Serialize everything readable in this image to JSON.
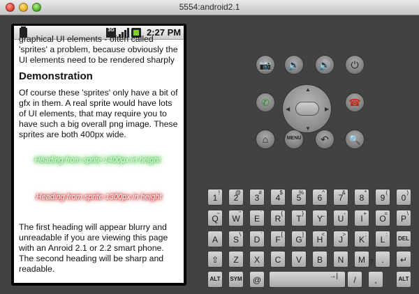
{
  "window": {
    "title": "5554:android2.1"
  },
  "statusbar": {
    "net": "3G",
    "time": "2:27 PM"
  },
  "page": {
    "intro": "graphical UI elements - often called 'sprites' a problem, because obviously the UI elements need to be rendered sharply",
    "heading": "Demonstration",
    "para1": "Of course these 'sprites' only have a bit of gfx in them. A real sprite would have lots of UI elements, that may require you to have such a big overall png image. These sprites are both 400px wide.",
    "sprite1": "Heading from sprite 1400px in height",
    "sprite2": "Heading from sprite 1300px in height",
    "para2": "The first heading will appear blurry and unreadable if you are viewing this page with an Anroid 2.1 or 2.2 smart phone. The second heading will be sharp and readable."
  },
  "controls": {
    "camera": "camera-icon",
    "vol_down": "volume-down-icon",
    "vol_up": "volume-up-icon",
    "power": "power-icon",
    "call": "call-icon",
    "end_call": "end-call-icon",
    "home": "home-icon",
    "menu_label": "MENU",
    "back": "back-icon",
    "search": "search-icon",
    "call_color": "#1e8f2a",
    "end_color": "#c42a1c"
  },
  "keyboard": {
    "row1": [
      {
        "k": "1",
        "s": "!"
      },
      {
        "k": "2",
        "s": "@"
      },
      {
        "k": "3",
        "s": "#"
      },
      {
        "k": "4",
        "s": "$"
      },
      {
        "k": "5",
        "s": "%"
      },
      {
        "k": "6",
        "s": "^"
      },
      {
        "k": "7",
        "s": "&"
      },
      {
        "k": "8",
        "s": "*"
      },
      {
        "k": "9",
        "s": "("
      },
      {
        "k": "0",
        "s": ")"
      }
    ],
    "row2": [
      {
        "k": "Q",
        "s": "~"
      },
      {
        "k": "W",
        "s": "\""
      },
      {
        "k": "E",
        "s": "`"
      },
      {
        "k": "R",
        "s": "{"
      },
      {
        "k": "T",
        "s": "}"
      },
      {
        "k": "Y",
        "s": "_"
      },
      {
        "k": "U",
        "s": "-"
      },
      {
        "k": "I",
        "s": "+"
      },
      {
        "k": "O",
        "s": "="
      },
      {
        "k": "P",
        "s": "\\"
      }
    ],
    "row3": [
      {
        "k": "A",
        "s": ""
      },
      {
        "k": "S",
        "s": "\\"
      },
      {
        "k": "D",
        "s": "'"
      },
      {
        "k": "F",
        "s": "["
      },
      {
        "k": "G",
        "s": "]"
      },
      {
        "k": "H",
        "s": "<"
      },
      {
        "k": "J",
        "s": ">"
      },
      {
        "k": "K",
        "s": ";"
      },
      {
        "k": "L",
        "s": ":"
      },
      {
        "k": "DEL",
        "s": ""
      }
    ],
    "row4": [
      {
        "k": "⇧",
        "s": ""
      },
      {
        "k": "Z",
        "s": ""
      },
      {
        "k": "X",
        "s": ""
      },
      {
        "k": "C",
        "s": ""
      },
      {
        "k": "V",
        "s": ""
      },
      {
        "k": "B",
        "s": ""
      },
      {
        "k": "N",
        "s": ""
      },
      {
        "k": "M",
        "s": ""
      },
      {
        "k": ".",
        "s": ""
      },
      {
        "k": "↵",
        "s": ""
      }
    ],
    "alt": "ALT",
    "sym": "SYM",
    "at": "@",
    "space_mark": "→|",
    "slash": "/",
    "comma": ",",
    "question": "?"
  }
}
